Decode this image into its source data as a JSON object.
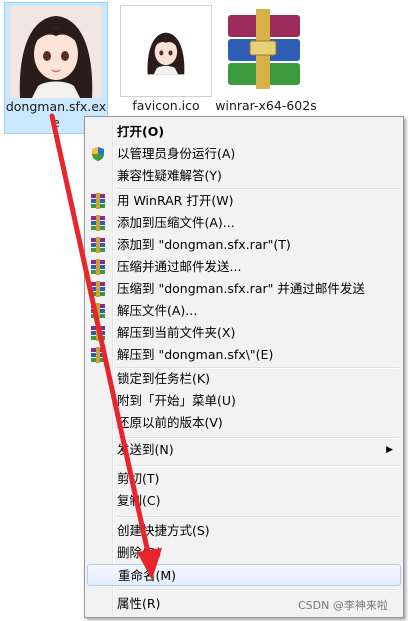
{
  "files": [
    {
      "name": "dongman.sfx.exe",
      "selected": true
    },
    {
      "name": "favicon.ico",
      "selected": false
    },
    {
      "name": "winrar-x64-602s",
      "selected": false
    }
  ],
  "menu": {
    "items": [
      {
        "label": "打开(O)",
        "bold": true,
        "icon": "none"
      },
      {
        "label": "以管理员身份运行(A)",
        "icon": "uac-shield-icon"
      },
      {
        "label": "兼容性疑难解答(Y)",
        "icon": "none"
      },
      {
        "label": "用 WinRAR 打开(W)",
        "icon": "winrar-icon"
      },
      {
        "label": "添加到压缩文件(A)...",
        "icon": "winrar-icon"
      },
      {
        "label": "添加到 \"dongman.sfx.rar\"(T)",
        "icon": "winrar-icon"
      },
      {
        "label": "压缩并通过邮件发送...",
        "icon": "winrar-icon"
      },
      {
        "label": "压缩到 \"dongman.sfx.rar\" 并通过邮件发送",
        "icon": "winrar-icon"
      },
      {
        "label": "解压文件(A)...",
        "icon": "winrar-icon"
      },
      {
        "label": "解压到当前文件夹(X)",
        "icon": "winrar-icon"
      },
      {
        "label": "解压到 \"dongman.sfx\\\"(E)",
        "icon": "winrar-icon"
      },
      {
        "label": "锁定到任务栏(K)",
        "icon": "none"
      },
      {
        "label": "附到「开始」菜单(U)",
        "icon": "none"
      },
      {
        "label": "还原以前的版本(V)",
        "icon": "none"
      },
      {
        "label": "发送到(N)",
        "icon": "none",
        "submenu": true
      },
      {
        "label": "剪切(T)",
        "icon": "none"
      },
      {
        "label": "复制(C)",
        "icon": "none"
      },
      {
        "label": "创建快捷方式(S)",
        "icon": "none"
      },
      {
        "label": "删除(D)",
        "icon": "none"
      },
      {
        "label": "重命名(M)",
        "icon": "none",
        "highlighted": true
      },
      {
        "label": "属性(R)",
        "icon": "none"
      }
    ],
    "submenu_arrow": "▶"
  },
  "watermark": "CSDN @李神来啦",
  "colors": {
    "selection_bg": "#cce8ff",
    "menu_bg": "#f2f2f2",
    "highlight_border": "#aeccf1",
    "arrow_red": "#e8252b"
  }
}
